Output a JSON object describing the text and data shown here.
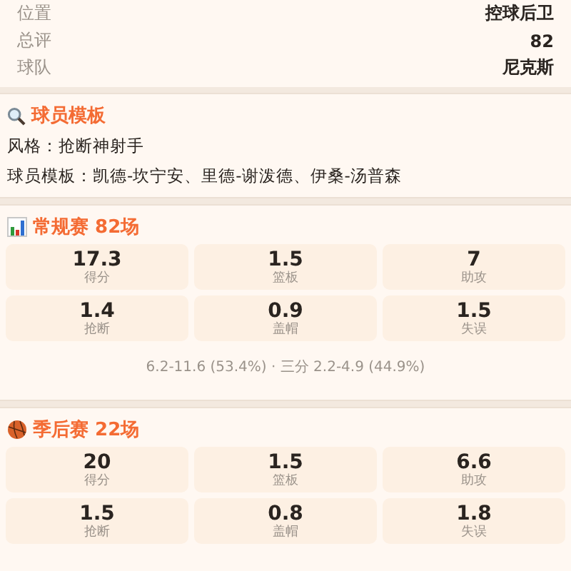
{
  "info_rows": [
    {
      "label": "位置",
      "value": "控球后卫"
    },
    {
      "label": "总评",
      "value": "82"
    },
    {
      "label": "球队",
      "value": "尼克斯"
    }
  ],
  "template": {
    "title": "球员模板",
    "lines": [
      "风格：抢断神射手",
      "球员模板：凯德-坎宁安、里德-谢泼德、伊桑-汤普森"
    ]
  },
  "sections": [
    {
      "kind": "chart",
      "title": "常规赛 82场",
      "stats": [
        {
          "value": "17.3",
          "label": "得分"
        },
        {
          "value": "1.5",
          "label": "篮板"
        },
        {
          "value": "7",
          "label": "助攻"
        },
        {
          "value": "1.4",
          "label": "抢断"
        },
        {
          "value": "0.9",
          "label": "盖帽"
        },
        {
          "value": "1.5",
          "label": "失误"
        }
      ],
      "note": "6.2-11.6 (53.4%) · 三分 2.2-4.9 (44.9%)"
    },
    {
      "kind": "ball",
      "title": "季后赛 22场",
      "stats": [
        {
          "value": "20",
          "label": "得分"
        },
        {
          "value": "1.5",
          "label": "篮板"
        },
        {
          "value": "6.6",
          "label": "助攻"
        },
        {
          "value": "1.5",
          "label": "抢断"
        },
        {
          "value": "0.8",
          "label": "盖帽"
        },
        {
          "value": "1.8",
          "label": "失误"
        }
      ]
    }
  ]
}
